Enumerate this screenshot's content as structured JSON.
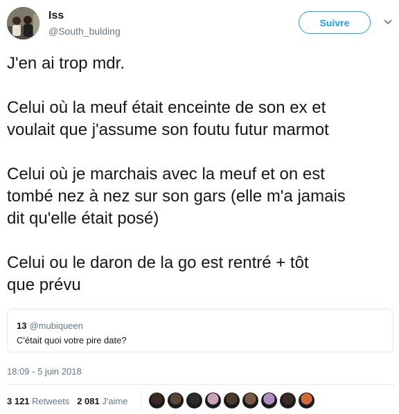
{
  "author": {
    "name": "Iss",
    "handle": "@South_bulding",
    "avatar_icon": "profile-photo"
  },
  "follow_label": "Suivre",
  "menu_icon": "chevron-down-icon",
  "tweet_lines": [
    "J'en ai trop mdr.",
    "",
    "Celui où la meuf était enceinte de son ex et",
    "voulait que j'assume son foutu futur marmot",
    "",
    "Celui où je marchais avec la meuf et on est",
    "tombé nez à nez sur son gars (elle m'a jamais",
    "dit qu'elle était posé)",
    "",
    "Celui ou le daron de la go est rentré + tôt",
    "que prévu"
  ],
  "quote": {
    "name": "13",
    "handle": "@mubiqueen",
    "text": "C'était quoi votre pire date?"
  },
  "timestamp": "18:09 - 5 juin 2018",
  "stats": {
    "retweets_count": "3 121",
    "retweets_label": "Retweets",
    "likes_count": "2 081",
    "likes_label": "J'aime"
  },
  "liker_colors": [
    "#3b2a24",
    "#5a4636",
    "#2c2c2c",
    "#c9a3b8",
    "#4a3a2e",
    "#7a5a46",
    "#b090c0",
    "#3a2a2a",
    "#d2693a"
  ],
  "colors": {
    "accent": "#1da1f2",
    "text": "#14171a",
    "muted": "#657786",
    "border": "#e1e8ed"
  }
}
